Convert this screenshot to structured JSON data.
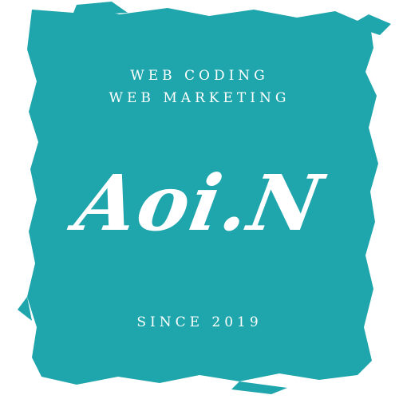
{
  "brand": {
    "name": "Aoi.N",
    "tagline_lines": [
      "WEB CODING",
      "WEB MARKETING"
    ],
    "since": "SINCE 2019"
  },
  "colors": {
    "panel": "#1fa5ac",
    "text": "#ffffff",
    "background": "#ffffff"
  }
}
